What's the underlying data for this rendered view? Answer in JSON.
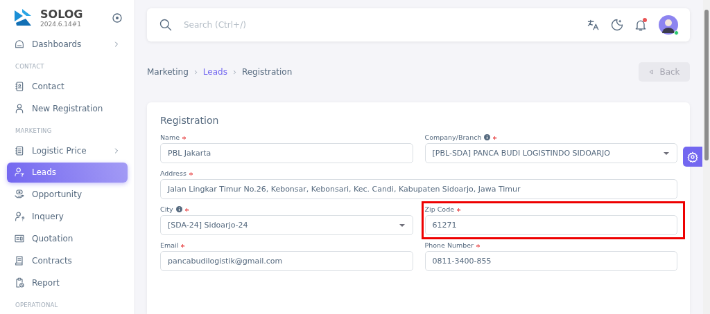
{
  "brand": {
    "name": "SOLOG",
    "version": "2024.6.14#1"
  },
  "sidebar": {
    "items": [
      {
        "kind": "link",
        "label": "Dashboards",
        "has_submenu": true,
        "selected": false
      },
      {
        "kind": "section",
        "label": "CONTACT"
      },
      {
        "kind": "link",
        "label": "Contact",
        "has_submenu": false,
        "selected": false
      },
      {
        "kind": "link",
        "label": "New Registration",
        "has_submenu": false,
        "selected": false
      },
      {
        "kind": "section",
        "label": "MARKETING"
      },
      {
        "kind": "link",
        "label": "Logistic Price",
        "has_submenu": true,
        "selected": false
      },
      {
        "kind": "link",
        "label": "Leads",
        "has_submenu": false,
        "selected": true
      },
      {
        "kind": "link",
        "label": "Opportunity",
        "has_submenu": false,
        "selected": false
      },
      {
        "kind": "link",
        "label": "Inquery",
        "has_submenu": false,
        "selected": false
      },
      {
        "kind": "link",
        "label": "Quotation",
        "has_submenu": false,
        "selected": false
      },
      {
        "kind": "link",
        "label": "Contracts",
        "has_submenu": false,
        "selected": false
      },
      {
        "kind": "link",
        "label": "Report",
        "has_submenu": false,
        "selected": false
      },
      {
        "kind": "section",
        "label": "OPERATIONAL"
      }
    ]
  },
  "topbar": {
    "search": {
      "placeholder": "Search (Ctrl+/)"
    },
    "notification_dot": true,
    "user_online": true
  },
  "breadcrumb": [
    {
      "label": "Marketing",
      "link": false
    },
    {
      "label": "Leads",
      "link": true
    },
    {
      "label": "Registration",
      "link": false
    }
  ],
  "back_button": {
    "label": "Back",
    "disabled": true
  },
  "form": {
    "title": "Registration",
    "fields": [
      {
        "kind": "text",
        "label": "Name",
        "required": true,
        "info": false,
        "value": "PBL Jakarta",
        "highlighted": false,
        "wide": false
      },
      {
        "kind": "select",
        "label": "Company/Branch",
        "required": true,
        "info": true,
        "value": "[PBL-SDA] PANCA BUDI LOGISTINDO SIDOARJO",
        "highlighted": false,
        "wide": false
      },
      {
        "kind": "text",
        "label": "Address",
        "required": true,
        "info": false,
        "value": "Jalan Lingkar Timur No.26, Kebonsar, Kebonsari, Kec. Candi, Kabupaten Sidoarjo, Jawa Timur",
        "highlighted": false,
        "wide": true
      },
      {
        "kind": "select",
        "label": "City",
        "required": true,
        "info": true,
        "value": "[SDA-24] Sidoarjo-24",
        "highlighted": false,
        "wide": false
      },
      {
        "kind": "text",
        "label": "Zip Code",
        "required": true,
        "info": false,
        "value": "61271",
        "highlighted": true,
        "wide": false
      },
      {
        "kind": "text",
        "label": "Email",
        "required": true,
        "info": false,
        "value": "pancabudilogistik@gmail.com",
        "highlighted": false,
        "wide": false
      },
      {
        "kind": "text",
        "label": "Phone Number",
        "required": true,
        "info": false,
        "value": "0811-3400-855",
        "highlighted": false,
        "wide": false
      }
    ]
  }
}
